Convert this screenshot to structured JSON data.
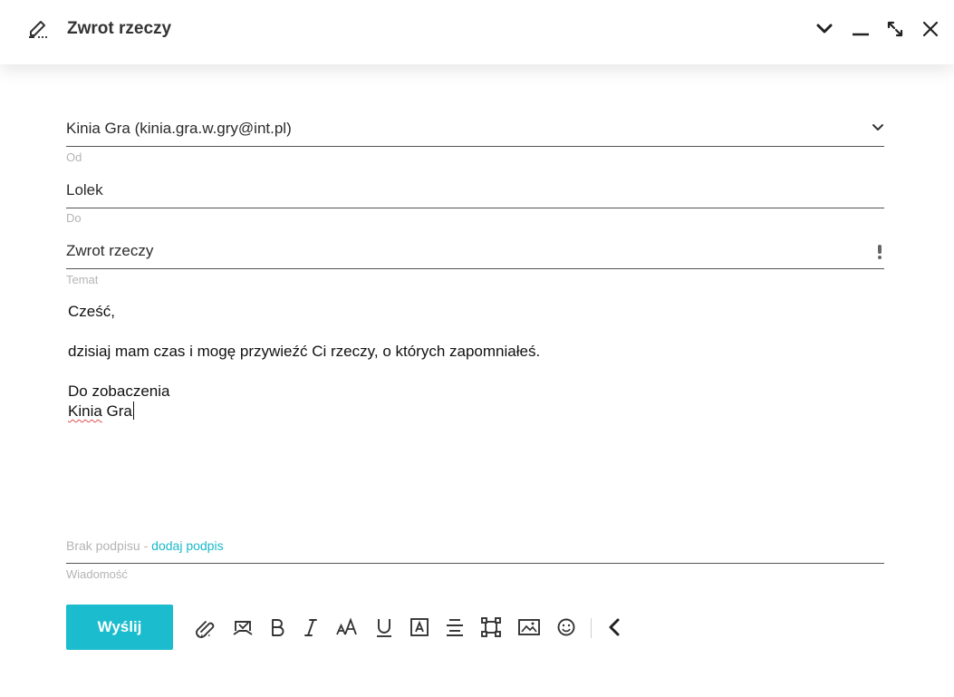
{
  "header": {
    "title": "Zwrot rzeczy",
    "icons": [
      "compose-icon",
      "chevron-down-icon",
      "minimize-icon",
      "expand-icon",
      "close-icon"
    ]
  },
  "form": {
    "from": {
      "value": "Kinia Gra (kinia.gra.w.gry@int.pl)",
      "label": "Od"
    },
    "to": {
      "value": "Lolek",
      "label": "Do"
    },
    "subject": {
      "value": "Zwrot rzeczy",
      "label": "Temat"
    }
  },
  "body": {
    "greeting": "Cześć,",
    "line1": "dzisiaj mam czas i mogę przywieźć Ci rzeczy, o których zapomniałeś.",
    "closing": "Do zobaczenia",
    "sign_first": "Kinia",
    "sign_last": " Gra"
  },
  "signature": {
    "text": "Brak podpisu - ",
    "link": "dodaj podpis"
  },
  "message_label": "Wiadomość",
  "toolbar": {
    "send_label": "Wyślij",
    "tools": [
      "attach-icon",
      "stamp-icon",
      "bold-icon",
      "italic-icon",
      "font-size-icon",
      "underline-icon",
      "text-color-icon",
      "align-center-icon",
      "crop-icon",
      "image-icon",
      "emoji-icon",
      "collapse-left-icon"
    ]
  },
  "colors": {
    "accent": "#1bbccd",
    "link": "#19b8c9",
    "label": "#b4b4b4",
    "underline_line": "#555555"
  }
}
